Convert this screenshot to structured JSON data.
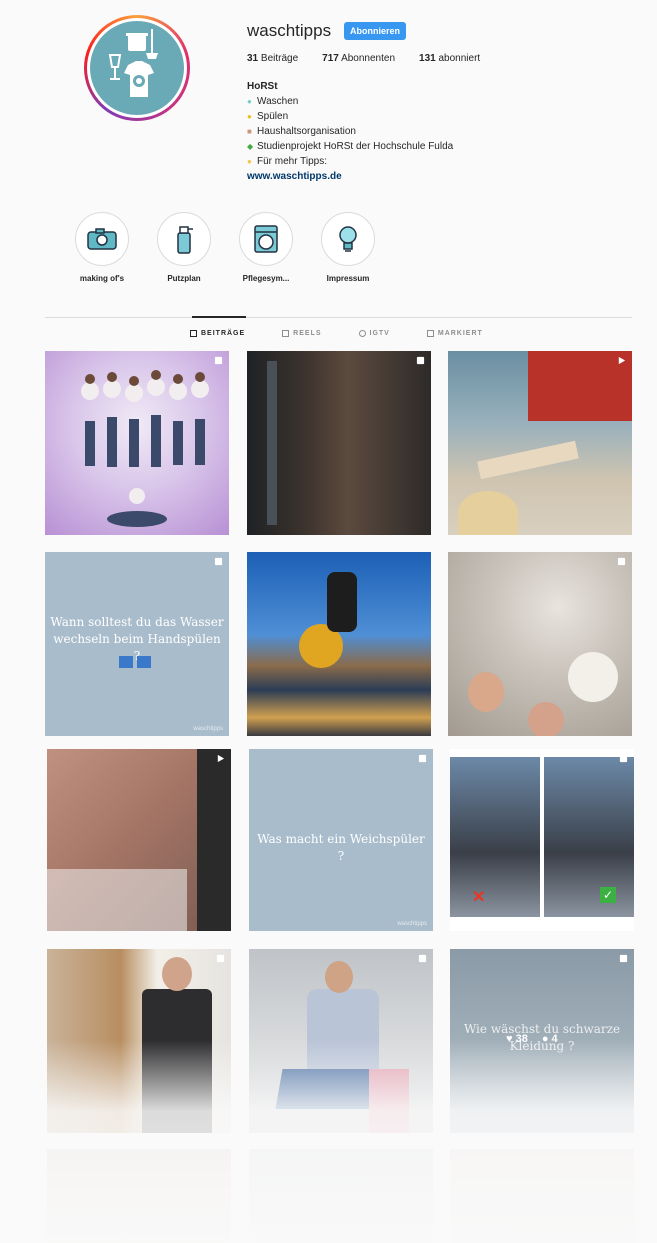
{
  "profile": {
    "username": "waschtipps",
    "follow_label": "Abonnieren",
    "posts_count": "31",
    "posts_label": "Beiträge",
    "followers_count": "717",
    "followers_label": "Abonnenten",
    "following_count": "131",
    "following_label": "abonniert",
    "bio_name": "HoRSt",
    "bio_lines": [
      "Waschen",
      "Spülen",
      "Haushaltsorganisation",
      "Studienprojekt HoRSt der Hochschule Fulda",
      "Für mehr Tipps:"
    ],
    "website": "www.waschtipps.de",
    "accent_color": "#3897f0",
    "avatar_color": "#6aa9b6"
  },
  "highlights": [
    {
      "label": "making of's",
      "icon": "camera-icon"
    },
    {
      "label": "Putzplan",
      "icon": "spray-bottle-icon"
    },
    {
      "label": "Pflegesym...",
      "icon": "washing-machine-icon"
    },
    {
      "label": "Impressum",
      "icon": "lightbulb-icon"
    }
  ],
  "tabs": [
    {
      "label": "BEITRÄGE",
      "active": true
    },
    {
      "label": "REELS",
      "active": false
    },
    {
      "label": "IGTV",
      "active": false
    },
    {
      "label": "MARKIERT",
      "active": false
    }
  ],
  "posts": {
    "p4_text": "Wann solltest du das Wasser wechseln beim Handspülen ?",
    "p4_wm": "waschtipps",
    "p8_text": "Was macht ein Weichspüler ?",
    "p8_wm": "waschtipps",
    "p12_text": "Wie wäschst du schwarze Kleidung ?",
    "p12_likes": "38",
    "p12_comments": "4"
  }
}
